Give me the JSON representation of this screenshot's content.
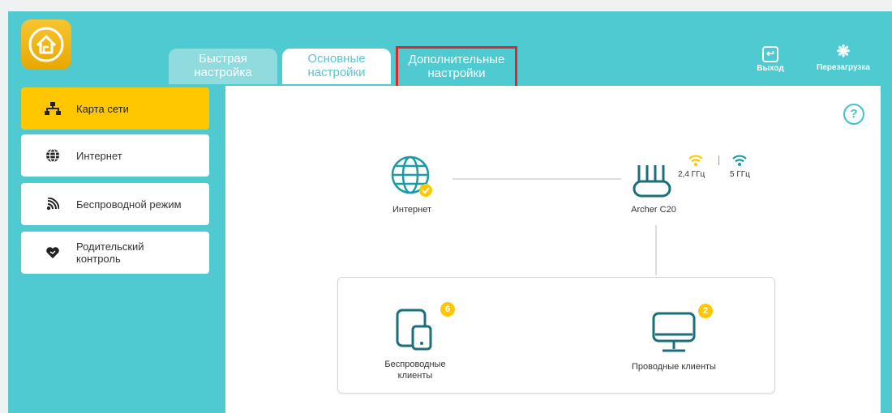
{
  "tabs": {
    "quick": "Быстрая настройка",
    "basic": "Основные настройки",
    "advanced": "Дополнительные настройки"
  },
  "top_actions": {
    "logout": "Выход",
    "reboot": "Перезагрузка"
  },
  "sidebar": {
    "items": [
      {
        "label": "Карта сети",
        "icon": "network-map-icon",
        "active": true
      },
      {
        "label": "Интернет",
        "icon": "globe-icon",
        "active": false
      },
      {
        "label": "Беспроводной режим",
        "icon": "wireless-icon",
        "active": false
      },
      {
        "label": "Родительский контроль",
        "icon": "heart-icon",
        "active": false
      }
    ]
  },
  "map": {
    "internet_label": "Интернет",
    "router_label": "Archer C20",
    "band_24": "2,4 ГГц",
    "band_5": "5 ГГц",
    "wireless_clients_label": "Беспроводные клиенты",
    "wireless_clients_count": "6",
    "wired_clients_label": "Проводные клиенты",
    "wired_clients_count": "2"
  },
  "help_symbol": "?",
  "colors": {
    "background": "#4ecad0",
    "accent": "#ffc700",
    "icon": "#1a6f7a",
    "highlight_border": "#e0262d"
  }
}
